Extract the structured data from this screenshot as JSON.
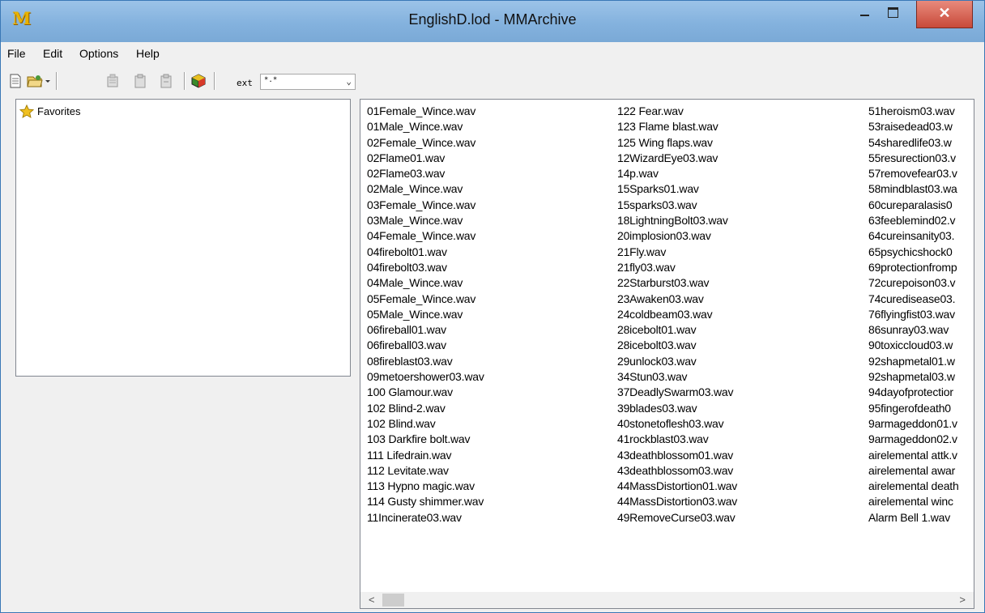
{
  "window": {
    "title": "EnglishD.lod - MMArchive",
    "app_icon_glyph": "M",
    "close_glyph": "✕"
  },
  "menu": [
    {
      "label": "File"
    },
    {
      "label": "Edit"
    },
    {
      "label": "Options"
    },
    {
      "label": "Help"
    }
  ],
  "toolbar": {
    "ext_label": "ext",
    "ext_value": "*.*",
    "icons": [
      "new-document-icon",
      "open-folder-icon",
      "dropdown-arrow-icon",
      "extract-icon",
      "paste-icon",
      "paste-alt-icon",
      "cube-icon"
    ]
  },
  "tree": {
    "items": [
      {
        "label": "Favorites",
        "icon": "star-icon"
      }
    ]
  },
  "files": {
    "col1": [
      "01Female_Wince.wav",
      "01Male_Wince.wav",
      "02Female_Wince.wav",
      "02Flame01.wav",
      "02Flame03.wav",
      "02Male_Wince.wav",
      "03Female_Wince.wav",
      "03Male_Wince.wav",
      "04Female_Wince.wav",
      "04firebolt01.wav",
      "04firebolt03.wav",
      "04Male_Wince.wav",
      "05Female_Wince.wav",
      "05Male_Wince.wav",
      "06fireball01.wav",
      "06fireball03.wav",
      "08fireblast03.wav",
      "09metoershower03.wav",
      "100 Glamour.wav",
      "102 Blind-2.wav",
      "102 Blind.wav",
      "103 Darkfire bolt.wav",
      "111 Lifedrain.wav",
      "112 Levitate.wav",
      "113 Hypno magic.wav",
      "114 Gusty shimmer.wav",
      "11Incinerate03.wav"
    ],
    "col2": [
      "122 Fear.wav",
      "123 Flame blast.wav",
      "125 Wing flaps.wav",
      "12WizardEye03.wav",
      "14p.wav",
      "15Sparks01.wav",
      "15sparks03.wav",
      "18LightningBolt03.wav",
      "20implosion03.wav",
      "21Fly.wav",
      "21fly03.wav",
      "22Starburst03.wav",
      "23Awaken03.wav",
      "24coldbeam03.wav",
      "28icebolt01.wav",
      "28icebolt03.wav",
      "29unlock03.wav",
      "34Stun03.wav",
      "37DeadlySwarm03.wav",
      "39blades03.wav",
      "40stonetoflesh03.wav",
      "41rockblast03.wav",
      "43deathblossom01.wav",
      "43deathblossom03.wav",
      "44MassDistortion01.wav",
      "44MassDistortion03.wav",
      "49RemoveCurse03.wav"
    ],
    "col3": [
      "51heroism03.wav",
      "53raisedead03.w",
      "54sharedlife03.w",
      "55resurection03.v",
      "57removefear03.v",
      "58mindblast03.wa",
      "60cureparalasis0",
      "63feeblemind02.v",
      "64cureinsanity03.",
      "65psychicshock0",
      "69protectionfromp",
      "72curepoison03.v",
      "74curedisease03.",
      "76flyingfist03.wav",
      "86sunray03.wav",
      "90toxiccloud03.w",
      "92shapmetal01.w",
      "92shapmetal03.w",
      "94dayofprotectior",
      "95fingerofdeath0",
      "9armageddon01.v",
      "9armageddon02.v",
      "airelemental attk.v",
      "airelemental awar",
      "airelemental death",
      "airelemental winc",
      "Alarm Bell 1.wav"
    ]
  },
  "scrollbar": {
    "left_glyph": "<",
    "right_glyph": ">"
  }
}
